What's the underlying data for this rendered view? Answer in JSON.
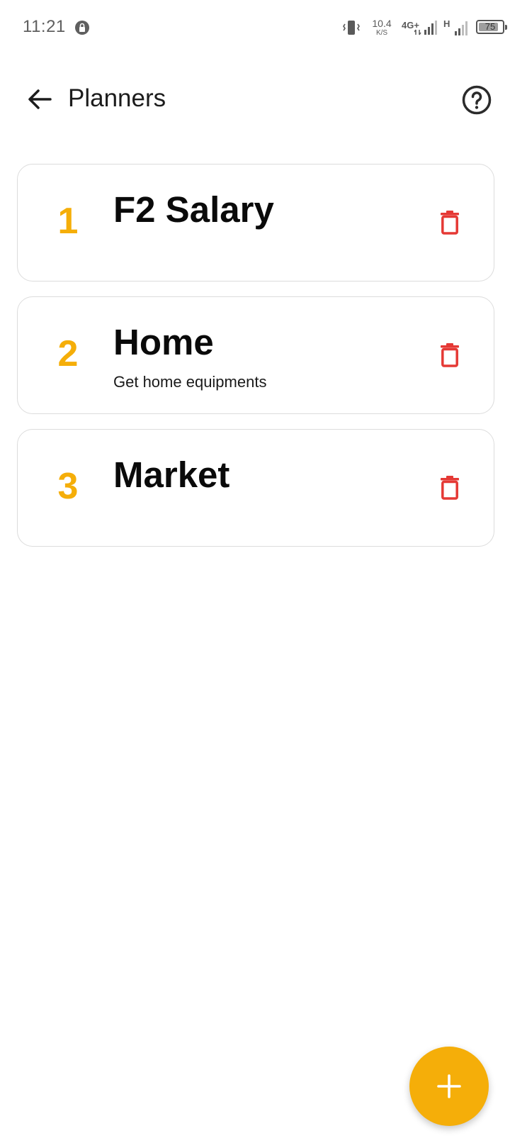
{
  "status_bar": {
    "time": "11:21",
    "network_speed_value": "10.4",
    "network_speed_unit": "K/S",
    "network_type": "4G+",
    "network_type_2": "H",
    "battery_level": "75",
    "icons": [
      "vpn-icon",
      "vibrate-icon",
      "signal-icon",
      "battery-icon"
    ]
  },
  "app_bar": {
    "title": "Planners",
    "back_icon": "arrow-left-icon",
    "help_icon": "help-circle-icon"
  },
  "planners": [
    {
      "index": "1",
      "name": "F2 Salary",
      "description": ""
    },
    {
      "index": "2",
      "name": "Home",
      "description": "Get home equipments"
    },
    {
      "index": "3",
      "name": "Market",
      "description": ""
    }
  ],
  "fab": {
    "icon": "plus-icon"
  },
  "colors": {
    "accent": "#f5ae09",
    "delete": "#e53935",
    "card_border": "#dcdcdc"
  }
}
